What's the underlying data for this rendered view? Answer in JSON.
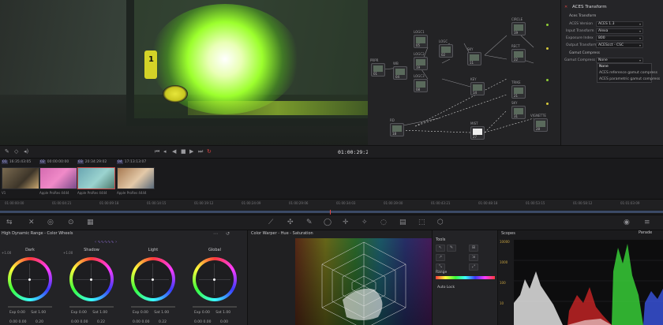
{
  "viewer": {
    "overlay_marker": "1",
    "timecode": "01:00:29:20"
  },
  "node_editor": {
    "nodes": [
      {
        "label": "LOGC1",
        "num": "05"
      },
      {
        "label": "LOGC2",
        "num": "19"
      },
      {
        "label": "LOGC3",
        "num": "08"
      },
      {
        "label": "CIRCLE",
        "num": "19"
      },
      {
        "label": "SKY",
        "num": "11"
      },
      {
        "label": "KEY",
        "num": "14"
      },
      {
        "label": "RECT",
        "num": "22"
      },
      {
        "label": "TRIKE",
        "num": "21"
      },
      {
        "label": "SKY",
        "num": "31"
      },
      {
        "label": "WB",
        "num": "04"
      },
      {
        "label": "LOGC",
        "num": "02"
      },
      {
        "label": "RD",
        "num": "18"
      },
      {
        "label": "MIST",
        "num": "27"
      },
      {
        "label": "VIGNETTE",
        "num": "28"
      },
      {
        "label": "PRPR",
        "num": "01"
      }
    ]
  },
  "inspector": {
    "title": "ACES Transform",
    "section1": "Aces Transform",
    "rows": [
      {
        "label": "ACES Version",
        "value": "ACES 1.3"
      },
      {
        "label": "Input Transform",
        "value": "Alexa"
      },
      {
        "label": "Exposure Index",
        "value": "800"
      },
      {
        "label": "Output Transform",
        "value": "ACEScct - CSC"
      }
    ],
    "section2": "Gamut Compress",
    "gamut_label": "Gamut Compress Type",
    "gamut_value": "None",
    "gamut_options": [
      "None",
      "ACES reference gamut compress",
      "ACES parametric gamut compress"
    ]
  },
  "clips": [
    {
      "index": "01",
      "tc": "16:35:43:05",
      "codec": "",
      "track": "V1"
    },
    {
      "index": "02",
      "tc": "00:00:00:00",
      "codec": "Apple ProRes 4444",
      "track": "V1"
    },
    {
      "index": "03",
      "tc": "20:34:29:02",
      "codec": "Apple ProRes 4444",
      "track": "V1"
    },
    {
      "index": "04",
      "tc": "17:13:13:07",
      "codec": "Apple ProRes 4444",
      "track": "V1"
    }
  ],
  "ruler_ticks": [
    "01:00:00:00",
    "01:00:04:21",
    "01:00:09:18",
    "01:00:14:15",
    "01:00:19:12",
    "01:00:24:09",
    "01:00:29:06",
    "01:00:34:03",
    "01:00:39:00",
    "01:00:43:21",
    "01:00:48:18",
    "01:00:53:15",
    "01:00:58:12",
    "01:01:03:09"
  ],
  "wheels_panel": {
    "title": "High Dynamic Range - Color Wheels",
    "wheels": [
      {
        "name": "Dark",
        "side": "+1.00",
        "exp": "0.00",
        "sat": "1.00",
        "val": "0.20"
      },
      {
        "name": "Shadow",
        "side": "+1.00",
        "exp": "0.00",
        "sat": "1.00",
        "val": "0.22"
      },
      {
        "name": "Light",
        "side": "",
        "exp": "0.00",
        "sat": "1.00",
        "val": "0.22"
      },
      {
        "name": "Global",
        "side": "",
        "exp": "0.00",
        "sat": "1.00",
        "val": "0.00"
      }
    ],
    "exp_label": "Exp",
    "sat_label": "Sat"
  },
  "warper": {
    "title": "Color Warper - Hue - Saturation"
  },
  "tools": {
    "title": "Tools",
    "range_label": "Range",
    "auto_lock": "Auto Lock"
  },
  "scopes": {
    "title": "Scopes",
    "mode": "Parade",
    "y_labels": [
      "10000",
      "1000",
      "100",
      "10"
    ]
  }
}
